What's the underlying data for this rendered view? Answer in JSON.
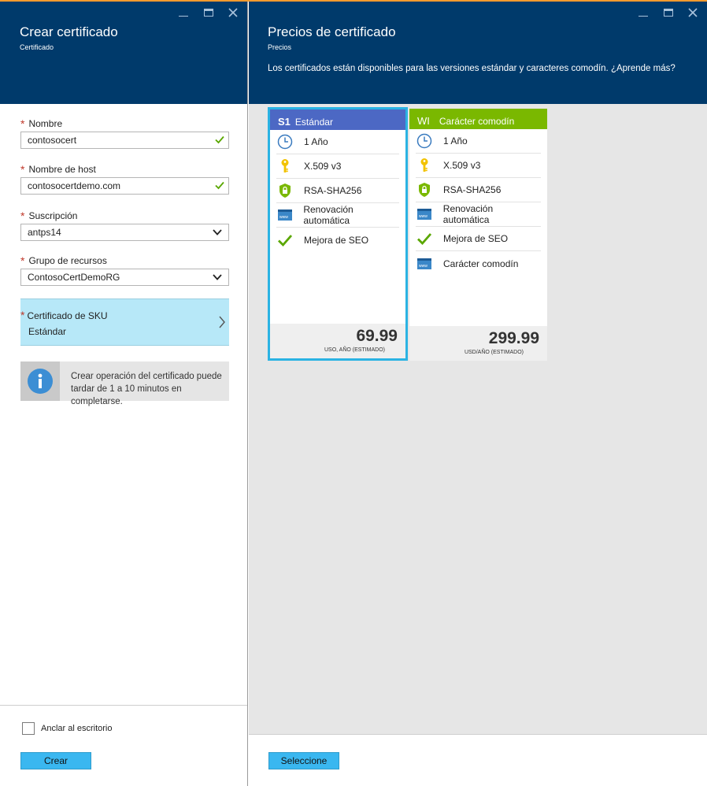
{
  "left_blade": {
    "title": "Crear certificado",
    "subtitle": "Certificado",
    "fields": [
      {
        "label": "Nombre",
        "value": "contosocert",
        "valid": true
      },
      {
        "label": "Nombre de host",
        "value": "contosocertdemo.com",
        "valid": true
      },
      {
        "label": "Suscripción",
        "value": "antps14"
      },
      {
        "label": "Grupo de recursos",
        "value": "ContosoCertDemoRG"
      }
    ],
    "sku": {
      "label": "Certificado de SKU",
      "value": "Estándar"
    },
    "info_text": "Crear operación del certificado puede tardar de 1 a 10 minutos en completarse.",
    "pin_label": "Anclar al escritorio",
    "pin_checked": false,
    "create_button": "Crear"
  },
  "right_blade": {
    "title": "Precios de certificado",
    "subtitle": "Precios",
    "description": "Los certificados están disponibles para las versiones estándar y caracteres comodín. ¿Aprende más?",
    "select_button": "Seleccione",
    "cards": [
      {
        "code": "S1",
        "name": "Estándar",
        "features": [
          {
            "icon": "clock-icon",
            "label": "1 Año"
          },
          {
            "icon": "key-icon",
            "label": "X.509 v3"
          },
          {
            "icon": "shield-lock-icon",
            "label": "RSA-SHA256"
          },
          {
            "icon": "www-window-icon",
            "label": "Renovación automática"
          },
          {
            "icon": "checkmark-icon",
            "label": "Mejora de SEO"
          }
        ],
        "price": "69.99",
        "unit": "USO, AÑO (ESTIMADO)"
      },
      {
        "code": "WI",
        "name": "Carácter comodín",
        "features": [
          {
            "icon": "clock-icon",
            "label": "1 Año"
          },
          {
            "icon": "key-icon",
            "label": "X.509 v3"
          },
          {
            "icon": "shield-lock-icon",
            "label": "RSA-SHA256"
          },
          {
            "icon": "www-window-icon",
            "label": "Renovación automática"
          },
          {
            "icon": "checkmark-icon",
            "label": "Mejora de SEO"
          },
          {
            "icon": "www-window-icon",
            "label": "Carácter comodín"
          }
        ],
        "price": "299.99",
        "unit": "USD/AÑO (ESTIMADO)"
      }
    ]
  },
  "colors": {
    "header": "#003a6b",
    "standard_card": "#4c68c4",
    "wildcard_card": "#7ab800",
    "selected_border": "#2bb3e3",
    "button": "#3ab7f0",
    "sku_highlight": "#b7e8f8"
  }
}
